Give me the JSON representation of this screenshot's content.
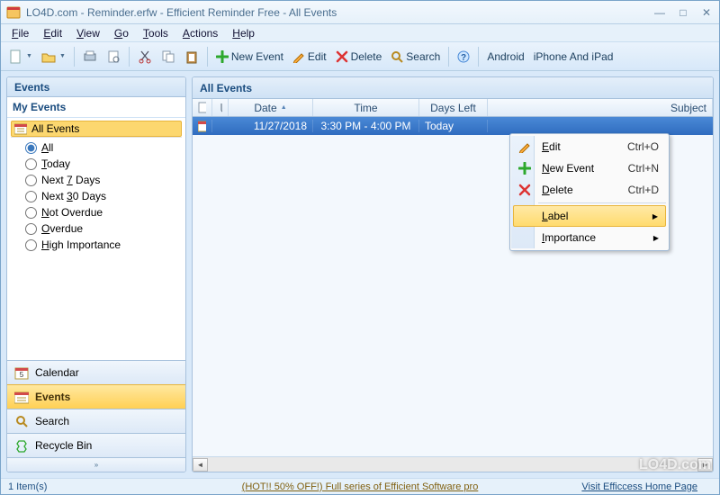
{
  "title": "LO4D.com - Reminder.erfw - Efficient Reminder Free - All Events",
  "menubar": [
    "File",
    "Edit",
    "View",
    "Go",
    "Tools",
    "Actions",
    "Help"
  ],
  "toolbar": {
    "new_event": "New Event",
    "edit": "Edit",
    "delete": "Delete",
    "search": "Search",
    "android": "Android",
    "iphone": "iPhone And iPad"
  },
  "sidebar": {
    "header": "Events",
    "group_label": "My Events",
    "tree_item": "All Events",
    "filters": [
      "All",
      "Today",
      "Next 7 Days",
      "Next 30 Days",
      "Not Overdue",
      "Overdue",
      "High Importance"
    ],
    "selected_filter": 0,
    "nav": [
      {
        "label": "Calendar",
        "icon": "calendar-icon"
      },
      {
        "label": "Events",
        "icon": "events-icon"
      },
      {
        "label": "Search",
        "icon": "search-icon"
      },
      {
        "label": "Recycle Bin",
        "icon": "recycle-icon"
      }
    ],
    "active_nav": 1
  },
  "content": {
    "title": "All Events",
    "columns": {
      "icon": "",
      "attach": "",
      "date": "Date",
      "time": "Time",
      "days": "Days Left",
      "subject": "Subject"
    },
    "rows": [
      {
        "date": "11/27/2018",
        "time": "3:30 PM - 4:00 PM",
        "days": "Today",
        "subject": ""
      }
    ]
  },
  "context_menu": {
    "items": [
      {
        "label": "Edit",
        "shortcut": "Ctrl+O",
        "icon": "pencil"
      },
      {
        "label": "New Event",
        "shortcut": "Ctrl+N",
        "icon": "plus"
      },
      {
        "label": "Delete",
        "shortcut": "Ctrl+D",
        "icon": "cross"
      },
      {
        "sep": true
      },
      {
        "label": "Label",
        "submenu": true,
        "hover": true
      },
      {
        "label": "Importance",
        "submenu": true
      }
    ]
  },
  "status": {
    "left": "1 Item(s)",
    "promo": "(HOT!! 50% OFF!) Full series of Efficient Software pro",
    "link": "Visit Efficcess Home Page"
  },
  "watermark": "LO4D.com"
}
